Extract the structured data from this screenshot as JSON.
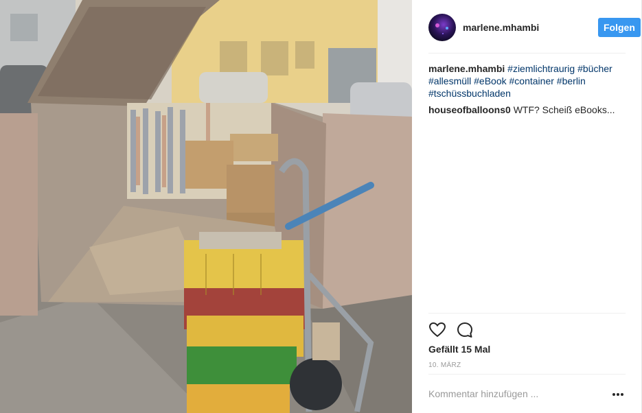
{
  "post": {
    "image_alt": "",
    "author": {
      "username": "marlene.mhambi",
      "follow_label": "Folgen"
    },
    "comments": [
      {
        "author": "marlene.mhambi",
        "text_parts": [
          "#ziemlichtraurig",
          "#bücher",
          "#allesmüll",
          "#eBook",
          "#container",
          "#berlin",
          "#tschüssbuchladen"
        ]
      },
      {
        "author": "houseofballoons0",
        "text": "WTF? Scheiß eBooks..."
      }
    ],
    "actions": {
      "like_icon": "heart-outline",
      "comment_icon": "speech-bubble-outline"
    },
    "likes_text": "Gefällt 15 Mal",
    "date_text": "10. März",
    "add_comment": {
      "placeholder": "Kommentar hinzufügen ...",
      "more_icon": "ellipsis"
    },
    "colors": {
      "follow_button": "#3897f0",
      "hashtag": "#003569",
      "secondary_text": "#999999"
    }
  }
}
